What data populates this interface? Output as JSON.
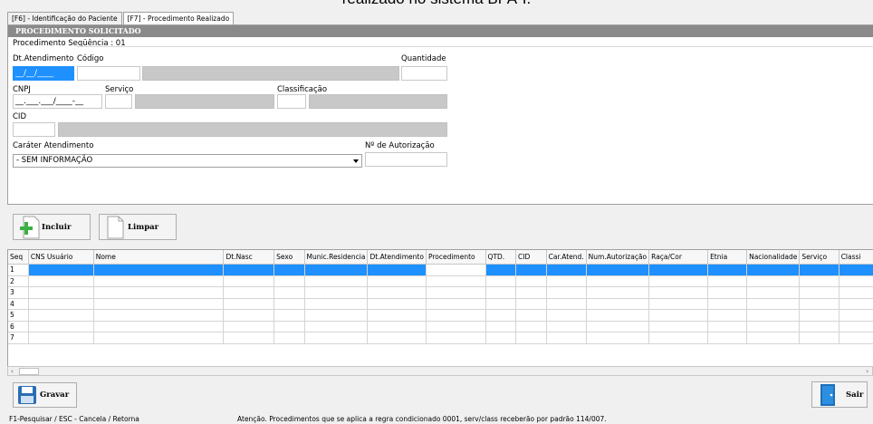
{
  "caption": "realizado no sistema BPA-I.",
  "tabs": [
    {
      "label": "[F6] - Identificação do Paciente"
    },
    {
      "label": "[F7] - Procedimento Realizado"
    }
  ],
  "section": {
    "title": "PROCEDIMENTO SOLICITADO"
  },
  "form": {
    "sequence_label": "Procedimento Seqüência : 01",
    "dt_atendimento_label": "Dt.Atendimento",
    "dt_atendimento_value": "__/__/____",
    "codigo_label": "Código",
    "quantidade_label": "Quantidade",
    "cnpj_label": "CNPJ",
    "cnpj_value": "__.___.___/____-__",
    "servico_label": "Serviço",
    "classificacao_label": "Classificação",
    "cid_label": "CID",
    "carater_label": "Caráter Atendimento",
    "carater_value": "- SEM INFORMAÇÃO",
    "autorizacao_label": "Nº de Autorização"
  },
  "buttons": {
    "incluir": "Incluir",
    "limpar": "Limpar",
    "gravar": "Gravar",
    "sair": "Sair"
  },
  "grid": {
    "headers": [
      "Seq",
      "CNS Usuário",
      "Nome",
      "Dt.Nasc",
      "Sexo",
      "Munic.Residencia",
      "Dt.Atendimento",
      "Procedimento",
      "QTD.",
      "CID",
      "Car.Atend.",
      "Num.Autorização",
      "Raça/Cor",
      "Etnia",
      "Nacionalidade",
      "Serviço",
      "Classi"
    ],
    "rows": [
      "1",
      "2",
      "3",
      "4",
      "5",
      "6",
      "7"
    ]
  },
  "status": {
    "left": "F1-Pesquisar  / ESC - Cancela / Retorna",
    "right": "Atenção. Procedimentos que se aplica a regra condicionado 0001, serv/class receberão por padrão 114/007."
  },
  "colors": {
    "selection": "#1e90ff",
    "header_bar": "#8a8a8a"
  }
}
